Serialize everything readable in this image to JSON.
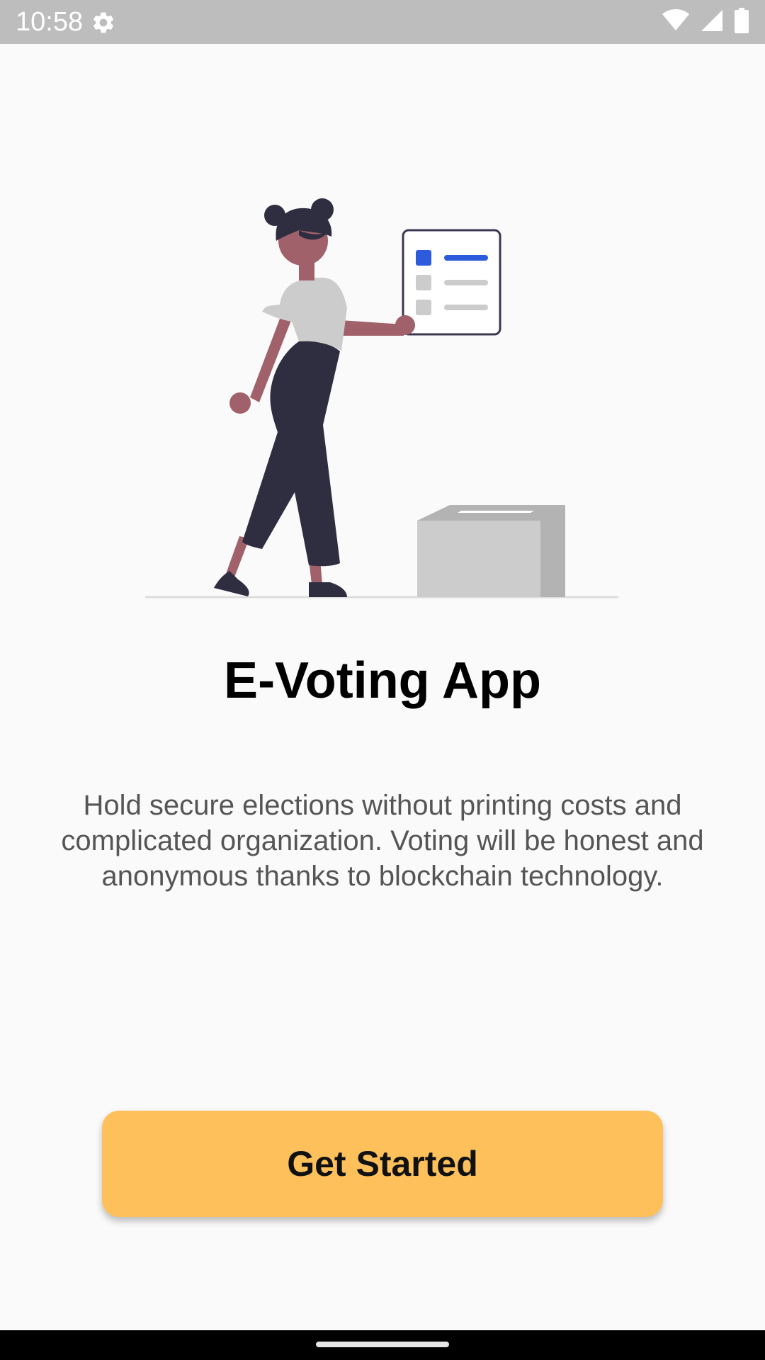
{
  "status_bar": {
    "time": "10:58",
    "icons": [
      "settings-gear-icon",
      "wifi-icon",
      "cellular-signal-icon",
      "battery-icon"
    ]
  },
  "illustration": {
    "icon": "woman-voting-illustration",
    "colors": {
      "skin": "#a0616a",
      "hair": "#2f2e41",
      "shirt": "#cccccc",
      "pants": "#2f2e41",
      "checklist_accent": "#2c5bdb",
      "ballot_box": "#cccccc",
      "ballot_box_shade": "#b3b3b3"
    }
  },
  "main": {
    "title": "E-Voting App",
    "description": "Hold secure elections without printing costs and complicated organization. Voting will be honest and anonymous thanks to blockchain technology.",
    "cta_label": "Get Started"
  },
  "colors": {
    "background": "#fafafa",
    "status_bar": "#bdbdbd",
    "button": "#fdc05b",
    "title_text": "#000000",
    "body_text": "#555555"
  }
}
